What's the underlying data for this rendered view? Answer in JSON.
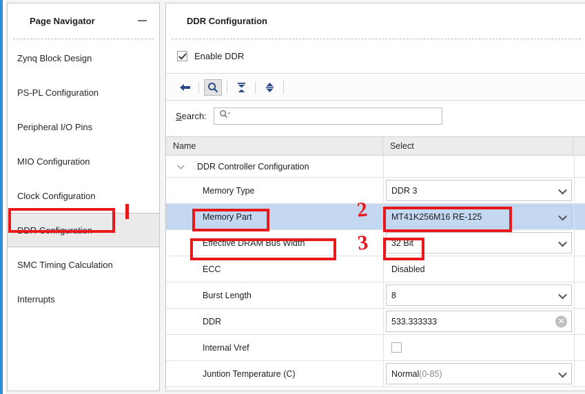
{
  "colors": {
    "accent_blue": "#2b8fd8",
    "selected_row": "#c4d8f2",
    "annotation_red": "#e8181b",
    "nav_selected": "#eaeaea"
  },
  "sidebar": {
    "title": "Page Navigator",
    "minimize_icon": "minimize-icon",
    "items": [
      {
        "label": "Zynq Block Design",
        "selected": false
      },
      {
        "label": "PS-PL Configuration",
        "selected": false
      },
      {
        "label": "Peripheral I/O Pins",
        "selected": false
      },
      {
        "label": "MIO Configuration",
        "selected": false
      },
      {
        "label": "Clock Configuration",
        "selected": false
      },
      {
        "label": "DDR Configuration",
        "selected": true
      },
      {
        "label": "SMC Timing Calculation",
        "selected": false
      },
      {
        "label": "Interrupts",
        "selected": false
      }
    ]
  },
  "content": {
    "title": "DDR Configuration",
    "enable": {
      "label": "Enable DDR",
      "checked": true
    },
    "toolbar": {
      "buttons": [
        {
          "icon": "back-arrow-icon",
          "active": false
        },
        {
          "icon": "search-icon",
          "active": true
        },
        {
          "icon": "collapse-all-icon",
          "active": false
        },
        {
          "icon": "expand-all-icon",
          "active": false
        }
      ]
    },
    "search": {
      "label_prefix": "S",
      "label_rest": "earch:",
      "icon": "search-dropdown-icon",
      "value": "",
      "placeholder": ""
    },
    "table": {
      "columns": [
        "Name",
        "Select"
      ],
      "rows": [
        {
          "kind": "group",
          "name": "DDR Controller Configuration",
          "expander": "chevron-down-icon",
          "select_kind": "none",
          "value": ""
        },
        {
          "kind": "item",
          "name": "Memory Type",
          "select_kind": "combo",
          "value": "DDR 3",
          "selected": false
        },
        {
          "kind": "item",
          "name": "Memory Part",
          "select_kind": "combo",
          "value": "MT41K256M16 RE-125",
          "selected": true
        },
        {
          "kind": "item",
          "name": "Effective DRAM Bus Width",
          "select_kind": "combo",
          "value": "32 Bit",
          "selected": false
        },
        {
          "kind": "item",
          "name": "ECC",
          "select_kind": "text",
          "value": "Disabled",
          "selected": false
        },
        {
          "kind": "item",
          "name": "Burst Length",
          "select_kind": "combo",
          "value": "8",
          "selected": false
        },
        {
          "kind": "item",
          "name": "DDR",
          "select_kind": "input-clear",
          "value": "533.333333",
          "clear_icon": "clear-circle-icon",
          "selected": false
        },
        {
          "kind": "item",
          "name": "Internal Vref",
          "select_kind": "checkbox",
          "value": "",
          "checked": false,
          "selected": false
        },
        {
          "kind": "item",
          "name": "Juntion Temperature (C)",
          "select_kind": "combo-muted",
          "value": "Normal ",
          "value_muted": "(0-85)",
          "selected": false
        }
      ]
    }
  },
  "annotations": [
    {
      "label": "1",
      "target": "sidebar-item-ddr-configuration"
    },
    {
      "label": "2",
      "target": "memory-part-row"
    },
    {
      "label": "3",
      "target": "effective-dram-bus-width-row"
    }
  ]
}
